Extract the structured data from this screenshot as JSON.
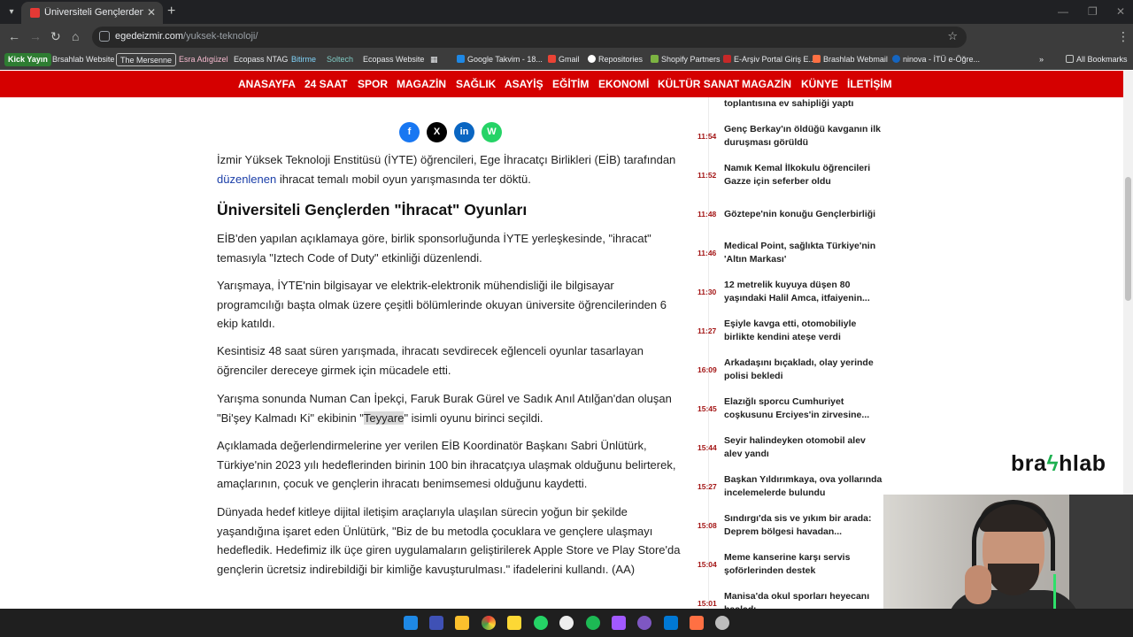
{
  "browser": {
    "tab_title": "Üniversiteli Gençlerden \"İhracat\" Oyunları",
    "url_domain": "egedeizmir.com",
    "url_path": "/yuksek-teknoloji/"
  },
  "bookmarks": {
    "items": [
      "Kick Yayın",
      "Brsahlab Website",
      "The Mersenne",
      "Esra Adıgüzel",
      "Ecopass NTAG",
      "Bitirme",
      "Soltech",
      "Ecopass Website",
      "Google Takvim - 18...",
      "Gmail",
      "Repositories",
      "Shopify Partners",
      "E-Arşiv Portal Giriş E...",
      "Brashlab Webmail",
      "ninova - İTÜ e-Öğre...",
      "All Bookmarks"
    ]
  },
  "site_nav": {
    "items": [
      "ANASAYFA",
      "24 SAAT",
      "SPOR",
      "MAGAZİN",
      "SAĞLIK",
      "ASAYİŞ",
      "EĞİTİM",
      "EKONOMİ",
      "KÜLTÜR SANAT",
      "MAGAZİN",
      "KÜNYE",
      "İLETİŞİM"
    ]
  },
  "share": {
    "facebook": "f",
    "x": "X",
    "linkedin": "in",
    "whatsapp": "W"
  },
  "article": {
    "intro_before_link": "İzmir Yüksek Teknoloji Enstitüsü (İYTE) öğrencileri, Ege İhracatçı Birlikleri (EİB) tarafından",
    "intro_link": "düzenlenen",
    "intro_after_link": " ihracat temalı mobil oyun yarışmasında ter döktü.",
    "heading": "Üniversiteli Gençlerden \"İhracat\" Oyunları",
    "p1": "EİB'den yapılan açıklamaya göre, birlik sponsorluğunda İYTE yerleşkesinde, \"ihracat\" temasıyla \"Iztech Code of Duty\" etkinliği düzenlendi.",
    "p2": "Yarışmaya, İYTE'nin bilgisayar ve elektrik-elektronik mühendisliği ile bilgisayar programcılığı başta olmak üzere çeşitli bölümlerinde okuyan üniversite öğrencilerinden 6 ekip katıldı.",
    "p3": "Kesintisiz 48 saat süren yarışmada, ihracatı sevdirecek eğlenceli oyunlar tasarlayan öğrenciler dereceye girmek için mücadele etti.",
    "p4_before": "Yarışma sonunda Numan Can İpekçi, Faruk Burak Gürel ve Sadık Anıl Atılğan'dan oluşan \"Bi'şey Kalmadı Ki\" ekibinin \"",
    "p4_highlight": "Teyyare",
    "p4_after": "\" isimli oyunu birinci seçildi.",
    "p5": "Açıklamada değerlendirmelerine yer verilen EİB Koordinatör Başkanı Sabri Ünlütürk, Türkiye'nin 2023 yılı hedeflerinden birinin 100 bin ihracatçıya ulaşmak olduğunu belirterek, amaçlarının, çocuk ve gençlerin ihracatı benimsemesi olduğunu kaydetti.",
    "p6": "Dünyada hedef kitleye dijital iletişim araçlarıyla ulaşılan sürecin yoğun bir şekilde yaşandığına işaret eden Ünlütürk, \"Biz de bu metodla çocuklara ve gençlere ulaşmayı hedefledik. Hedefimiz ilk üçe giren uygulamaların geliştirilerek Apple Store ve Play Store'da gençlerin ücretsiz indirebildiği bir kimliğe kavuşturulması.\" ifadelerini kullandı. (AA)"
  },
  "sidebar": {
    "news": [
      {
        "time": "",
        "title": "toplantısına ev sahipliği yaptı"
      },
      {
        "time": "11:54",
        "title": "Genç Berkay'ın öldüğü kavganın ilk duruşması görüldü"
      },
      {
        "time": "11:52",
        "title": "Namık Kemal İlkokulu öğrencileri Gazze için seferber oldu"
      },
      {
        "time": "11:48",
        "title": "Göztepe'nin konuğu Gençlerbirliği"
      },
      {
        "time": "11:46",
        "title": "Medical Point, sağlıkta Türkiye'nin 'Altın Markası'"
      },
      {
        "time": "11:30",
        "title": "12 metrelik kuyuya düşen 80 yaşındaki Halil Amca, itfaiyenin..."
      },
      {
        "time": "11:27",
        "title": "Eşiyle kavga etti, otomobiliyle birlikte kendini ateşe verdi"
      },
      {
        "time": "16:09",
        "title": "Arkadaşını bıçakladı, olay yerinde polisi bekledi"
      },
      {
        "time": "15:45",
        "title": "Elazığlı sporcu Cumhuriyet coşkusunu Erciyes'in zirvesine..."
      },
      {
        "time": "15:44",
        "title": "Seyir halindeyken otomobil alev alev yandı"
      },
      {
        "time": "15:27",
        "title": "Başkan Yıldırımkaya, ova yollarında incelemelerde bulundu"
      },
      {
        "time": "15:08",
        "title": "Sındırgı'da sis ve yıkım bir arada: Deprem bölgesi havadan..."
      },
      {
        "time": "15:04",
        "title": "Meme kanserine karşı servis şoförlerinden destek"
      },
      {
        "time": "15:01",
        "title": "Manisa'da okul sporları heyecanı başladı"
      }
    ]
  },
  "brand": {
    "left": "bra",
    "bolt": "ϟ",
    "right": "hlab"
  },
  "colors": {
    "nav_red": "#d50000",
    "time_red": "#a31515",
    "link_blue": "#1a3ea8",
    "brand_green": "#1eb050"
  }
}
